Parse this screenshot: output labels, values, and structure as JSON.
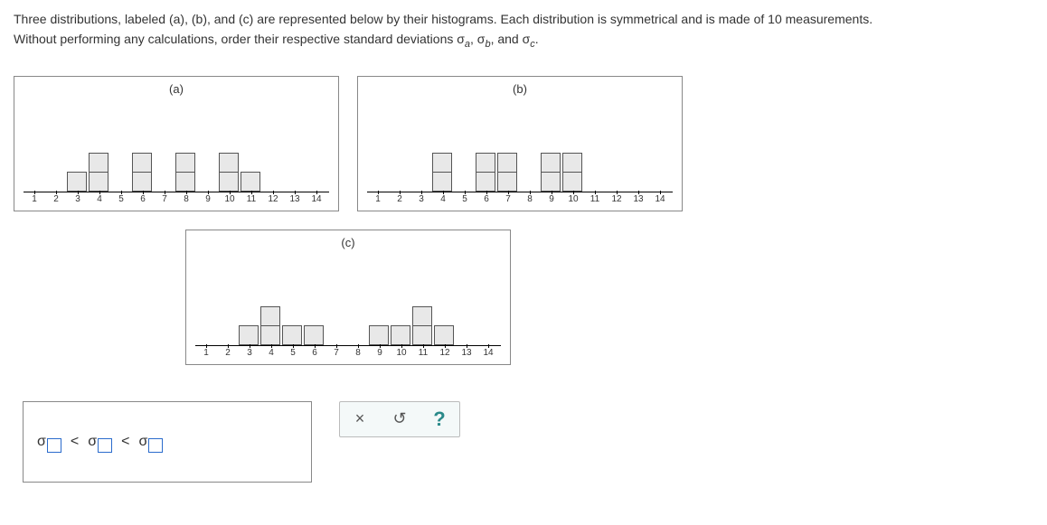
{
  "question": {
    "line1_prefix": "Three distributions, labeled (a), (b), and (c) are represented below by their histograms. Each distribution is symmetrical and is made of ",
    "count": "10",
    "line1_suffix": " measurements.",
    "line2_prefix": "Without performing any calculations, order their respective standard deviations ",
    "sig_a": "σ",
    "sub_a": "a",
    "sig_b": "σ",
    "sub_b": "b",
    "sig_c": "σ",
    "sub_c": "c",
    "comma1": ", ",
    "comma2": ", and ",
    "period": "."
  },
  "axis_labels": [
    "1",
    "2",
    "3",
    "4",
    "5",
    "6",
    "7",
    "8",
    "9",
    "10",
    "11",
    "12",
    "13",
    "14"
  ],
  "chart_data": [
    {
      "label": "(a)",
      "type": "bar",
      "x": [
        1,
        2,
        3,
        4,
        5,
        6,
        7,
        8,
        9,
        10,
        11,
        12,
        13,
        14
      ],
      "counts": [
        0,
        0,
        1,
        2,
        0,
        2,
        0,
        2,
        0,
        2,
        1,
        0,
        0,
        0
      ]
    },
    {
      "label": "(b)",
      "type": "bar",
      "x": [
        1,
        2,
        3,
        4,
        5,
        6,
        7,
        8,
        9,
        10,
        11,
        12,
        13,
        14
      ],
      "counts": [
        0,
        0,
        0,
        2,
        0,
        2,
        2,
        0,
        2,
        2,
        0,
        0,
        0,
        0
      ]
    },
    {
      "label": "(c)",
      "type": "bar",
      "x": [
        1,
        2,
        3,
        4,
        5,
        6,
        7,
        8,
        9,
        10,
        11,
        12,
        13,
        14
      ],
      "counts": [
        0,
        0,
        1,
        2,
        1,
        1,
        0,
        0,
        1,
        1,
        2,
        1,
        0,
        0
      ]
    }
  ],
  "answer": {
    "sigma": "σ",
    "lt": "<"
  },
  "controls": {
    "clear": "×",
    "reset": "↺",
    "help": "?"
  }
}
